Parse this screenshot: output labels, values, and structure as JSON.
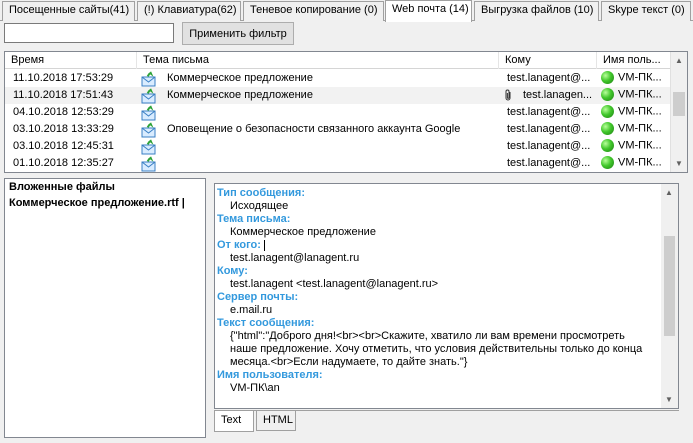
{
  "tabs": [
    {
      "label": "Посещенные сайты(41)"
    },
    {
      "label": "(!) Клавиатура(62)"
    },
    {
      "label": "Теневое копирование (0)"
    },
    {
      "label": "Web почта (14)"
    },
    {
      "label": "Выгрузка файлов (10)"
    },
    {
      "label": "Skype текст (0)"
    }
  ],
  "filter": {
    "input_value": "",
    "apply_label": "Применить фильтр"
  },
  "table": {
    "columns": {
      "time": "Время",
      "subject": "Тема письма",
      "to": "Кому",
      "user": "Имя поль..."
    },
    "rows": [
      {
        "time": "11.10.2018 17:53:29",
        "subject": "Коммерческое предложение",
        "to": "test.lanagent@...",
        "user": "VM-ПК...",
        "attachment": false
      },
      {
        "time": "11.10.2018 17:51:43",
        "subject": "Коммерческое предложение",
        "to": "test.lanagen...",
        "user": "VM-ПК...",
        "attachment": true
      },
      {
        "time": "04.10.2018 12:53:29",
        "subject": "",
        "to": "test.lanagent@...",
        "user": "VM-ПК...",
        "attachment": false
      },
      {
        "time": "03.10.2018 13:33:29",
        "subject": "Оповещение о безопасности связанного аккаунта Google",
        "to": "test.lanagent@...",
        "user": "VM-ПК...",
        "attachment": false
      },
      {
        "time": "03.10.2018 12:45:31",
        "subject": "",
        "to": "test.lanagent@...",
        "user": "VM-ПК...",
        "attachment": false
      },
      {
        "time": "01.10.2018 12:35:27",
        "subject": "",
        "to": "test.lanagent@...",
        "user": "VM-ПК...",
        "attachment": false
      }
    ],
    "status_color": "#41c72b"
  },
  "attachments": {
    "title": "Вложенные файлы",
    "items": [
      "Коммерческое предложение.rtf |"
    ]
  },
  "details": {
    "label_color": "#3399dd",
    "message_type_label": "Тип сообщения:",
    "message_type": "Исходящее",
    "subject_label": "Тема письма:",
    "subject": "Коммерческое предложение",
    "from_label": "От кого:",
    "from": "test.lanagent@lanagent.ru",
    "to_label": "Кому:",
    "to": "test.lanagent <test.lanagent@lanagent.ru>",
    "server_label": "Сервер почты:",
    "server": "e.mail.ru",
    "text_label": "Текст сообщения:",
    "text": "{\"html\":\"Доброго дня!<br><br>Скажите, хватило ли вам времени просмотреть наше предложение. Хочу отметить, что условия действительны только до конца месяца.<br>Если надумаете, то дайте знать.\"}",
    "user_label": "Имя пользователя:",
    "user": "VM-ПК\\an"
  },
  "bottom_tabs": [
    {
      "label": "Text"
    },
    {
      "label": "HTML"
    }
  ]
}
